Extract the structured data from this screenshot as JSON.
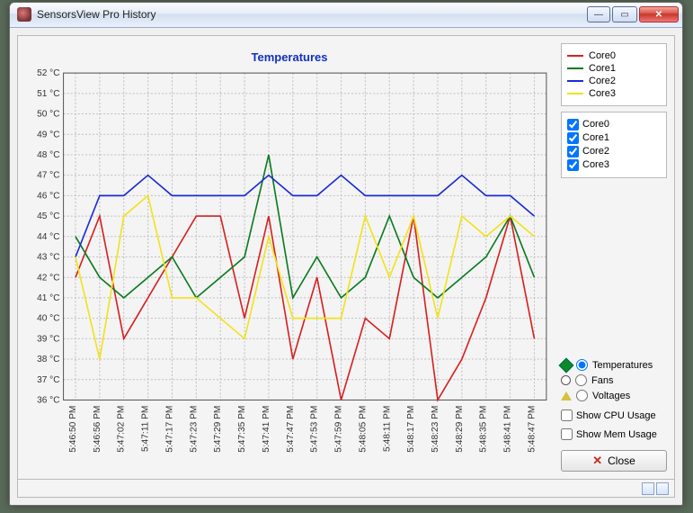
{
  "window": {
    "title": "SensorsView Pro History"
  },
  "chart_data": {
    "type": "line",
    "title": "Temperatures",
    "xlabel": "",
    "ylabel": "",
    "ylim": [
      36,
      52
    ],
    "y_unit": "°C",
    "categories": [
      "5:46:50 PM",
      "5:46:56 PM",
      "5:47:02 PM",
      "5:47:11 PM",
      "5:47:17 PM",
      "5:47:23 PM",
      "5:47:29 PM",
      "5:47:35 PM",
      "5:47:41 PM",
      "5:47:47 PM",
      "5:47:53 PM",
      "5:47:59 PM",
      "5:48:05 PM",
      "5:48:11 PM",
      "5:48:17 PM",
      "5:48:23 PM",
      "5:48:29 PM",
      "5:48:35 PM",
      "5:48:41 PM",
      "5:48:47 PM"
    ],
    "series": [
      {
        "name": "Core0",
        "color": "#d72020",
        "values": [
          42,
          45,
          39,
          41,
          43,
          45,
          45,
          40,
          45,
          38,
          42,
          36,
          40,
          39,
          45,
          36,
          38,
          41,
          45,
          39
        ]
      },
      {
        "name": "Core1",
        "color": "#0a7a1f",
        "values": [
          44,
          42,
          41,
          42,
          43,
          41,
          42,
          43,
          48,
          41,
          43,
          41,
          42,
          45,
          42,
          41,
          42,
          43,
          45,
          42
        ]
      },
      {
        "name": "Core2",
        "color": "#1a2bd6",
        "values": [
          43,
          46,
          46,
          47,
          46,
          46,
          46,
          46,
          47,
          46,
          46,
          47,
          46,
          46,
          46,
          46,
          47,
          46,
          46,
          45
        ]
      },
      {
        "name": "Core3",
        "color": "#f2e21a",
        "values": [
          43,
          38,
          45,
          46,
          41,
          41,
          40,
          39,
          44,
          40,
          40,
          40,
          45,
          42,
          45,
          40,
          45,
          44,
          45,
          44
        ]
      }
    ]
  },
  "legend": {
    "items": [
      "Core0",
      "Core1",
      "Core2",
      "Core3"
    ]
  },
  "checklist": {
    "items": [
      {
        "label": "Core0",
        "checked": true
      },
      {
        "label": "Core1",
        "checked": true
      },
      {
        "label": "Core2",
        "checked": true
      },
      {
        "label": "Core3",
        "checked": true
      }
    ]
  },
  "radios": {
    "options": [
      {
        "label": "Temperatures",
        "selected": true
      },
      {
        "label": "Fans",
        "selected": false
      },
      {
        "label": "Voltages",
        "selected": false
      }
    ]
  },
  "toggles": {
    "show_cpu": {
      "label": "Show CPU Usage",
      "checked": false
    },
    "show_mem": {
      "label": "Show Mem Usage",
      "checked": false
    }
  },
  "buttons": {
    "close": "Close"
  }
}
